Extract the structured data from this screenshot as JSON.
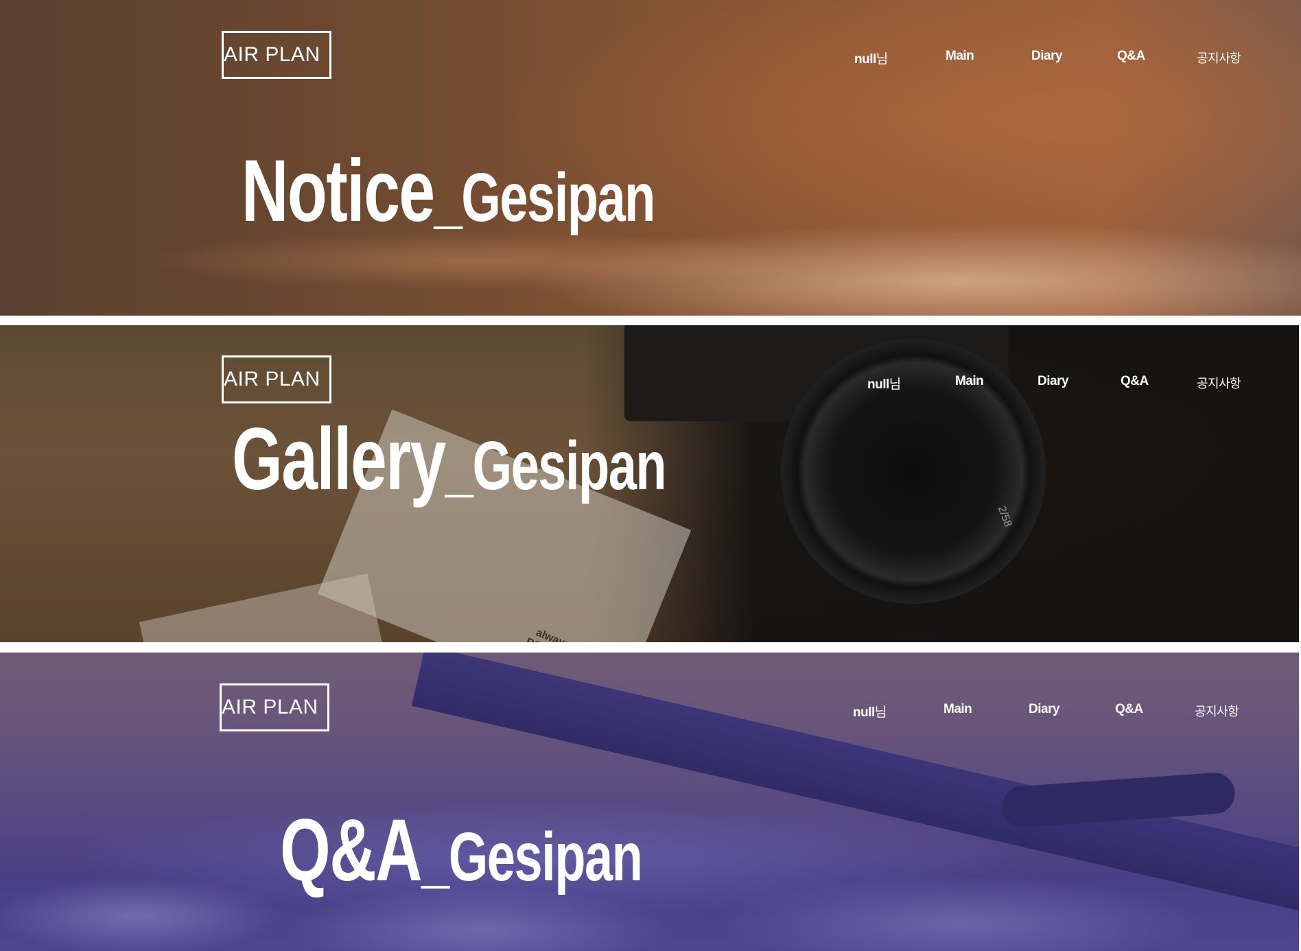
{
  "logo": "AIR PLAN",
  "nav": {
    "user_prefix": "null",
    "user_suffix": "님",
    "main": "Main",
    "diary": "Diary",
    "qa": "Q&A",
    "notice": "공지사항"
  },
  "banners": [
    {
      "title_main": "Notice",
      "title_sub": "_Gesipan"
    },
    {
      "title_main": "Gallery",
      "title_sub": "_Gesipan"
    },
    {
      "title_main": "Q&A",
      "title_sub": "_Gesipan"
    }
  ],
  "photo_caption": [
    "always smile!",
    "PONY BROWN"
  ],
  "lens_text": "2/58"
}
